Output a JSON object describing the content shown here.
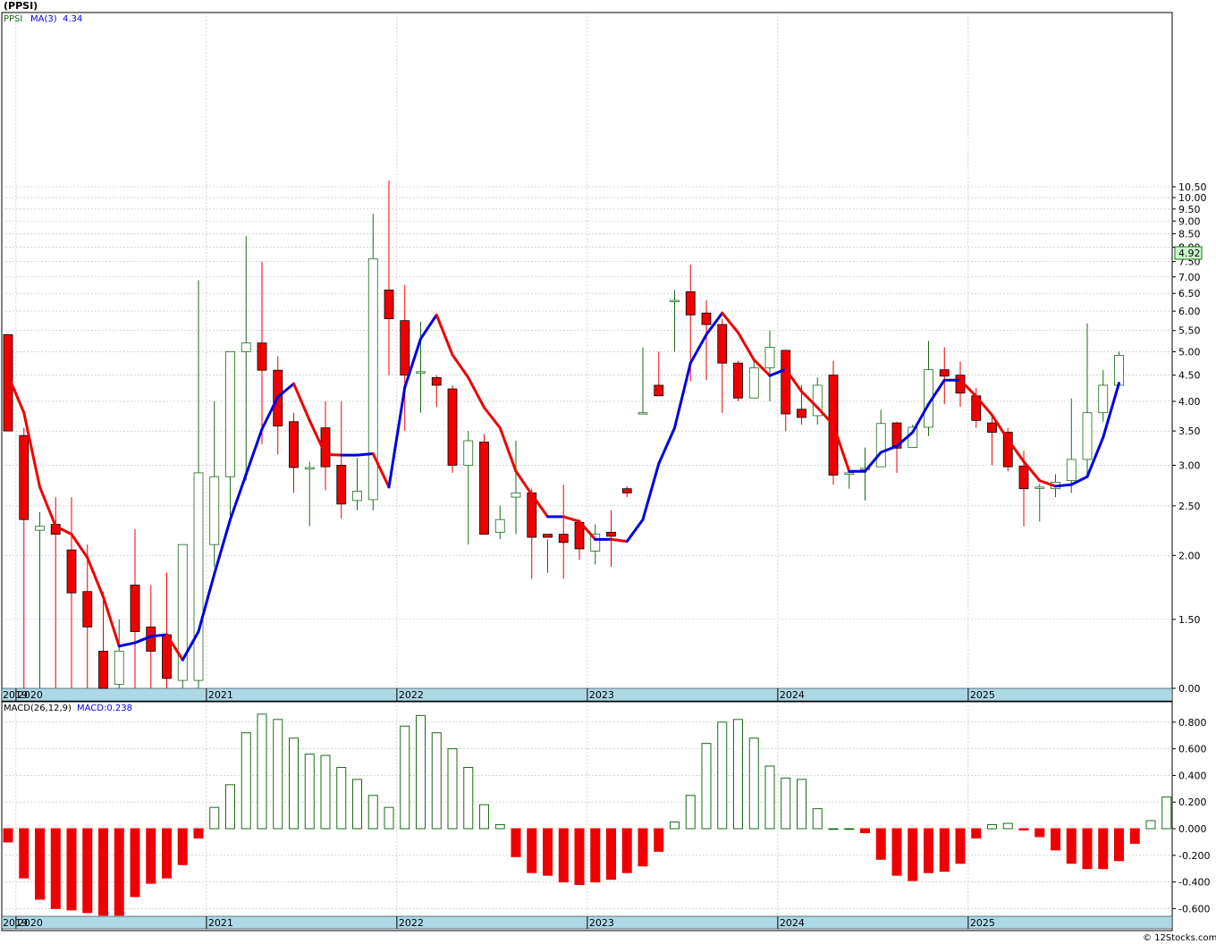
{
  "title": "(PPSI)",
  "credit": "© 12Stocks.com",
  "colors": {
    "up": "#1a6b1a",
    "down": "#ee0000",
    "ma_up": "#0000dd",
    "ma_down": "#ee0000",
    "axis_band": "#add8e6",
    "last_price_bg": "#ccffcc"
  },
  "price_panel": {
    "legend": {
      "symbol": "PPSI",
      "ma_label": "MA(3)",
      "ma_value": "4.34"
    },
    "last_price": "4.92",
    "y_ticks": [
      "10.50",
      "10.00",
      "9.50",
      "9.00",
      "8.50",
      "8.00",
      "7.50",
      "7.00",
      "6.50",
      "6.00",
      "5.50",
      "5.00",
      "4.50",
      "4.00",
      "3.50",
      "3.00",
      "2.50",
      "2.00",
      "1.50",
      "0.00"
    ],
    "year_labels": [
      "2019",
      "2020",
      "2021",
      "2022",
      "2023",
      "2024",
      "2025"
    ]
  },
  "macd_panel": {
    "legend": {
      "label": "MACD(26,12,9)",
      "value_label": "MACD:0.238"
    },
    "y_ticks": [
      "0.800",
      "0.600",
      "0.400",
      "0.200",
      "0.000",
      "-0.200",
      "-0.400",
      "-0.600"
    ],
    "year_labels": [
      "2019",
      "2020",
      "2021",
      "2022",
      "2023",
      "2024",
      "2025"
    ]
  },
  "chart_data": [
    {
      "type": "candlestick",
      "title": "(PPSI)",
      "x": [
        "2019-12",
        "2020-01",
        "2020-02",
        "2020-03",
        "2020-04",
        "2020-05",
        "2020-06",
        "2020-07",
        "2020-08",
        "2020-09",
        "2020-10",
        "2020-11",
        "2020-12",
        "2021-01",
        "2021-02",
        "2021-03",
        "2021-04",
        "2021-05",
        "2021-06",
        "2021-07",
        "2021-08",
        "2021-09",
        "2021-10",
        "2021-11",
        "2021-12",
        "2022-01",
        "2022-02",
        "2022-03",
        "2022-04",
        "2022-05",
        "2022-06",
        "2022-07",
        "2022-08",
        "2022-09",
        "2022-10",
        "2022-11",
        "2022-12",
        "2023-01",
        "2023-02",
        "2023-03",
        "2023-04",
        "2023-05",
        "2023-06",
        "2023-07",
        "2023-08",
        "2023-09",
        "2023-10",
        "2023-11",
        "2023-12",
        "2024-01",
        "2024-02",
        "2024-03",
        "2024-04",
        "2024-05",
        "2024-06",
        "2024-07",
        "2024-08",
        "2024-09",
        "2024-10",
        "2024-11",
        "2024-12",
        "2025-01",
        "2025-02",
        "2025-03",
        "2025-04",
        "2025-05",
        "2025-06",
        "2025-07",
        "2025-08",
        "2025-09",
        "2025-10",
        "2025-11",
        "2025-12"
      ],
      "open": [
        5.4,
        3.43,
        2.24,
        2.3,
        2.05,
        1.7,
        1.3,
        1.12,
        1.75,
        1.45,
        1.4,
        1.14,
        1.14,
        2.1,
        2.85,
        5.0,
        5.2,
        4.6,
        3.65,
        2.95,
        3.55,
        3.0,
        2.56,
        2.57,
        6.6,
        5.75,
        4.55,
        4.45,
        4.23,
        3.0,
        3.33,
        2.22,
        2.6,
        2.65,
        2.2,
        2.2,
        2.32,
        2.04,
        2.22,
        2.7,
        3.8,
        4.3,
        6.3,
        6.55,
        5.95,
        5.65,
        4.75,
        4.06,
        4.65,
        5.03,
        3.86,
        3.75,
        4.5,
        2.88,
        2.95,
        2.98,
        3.63,
        3.25,
        3.56,
        4.61,
        4.5,
        4.1,
        3.63,
        3.48,
        2.99,
        2.72,
        2.7,
        2.8,
        3.08,
        3.8,
        4.3
      ],
      "close": [
        3.5,
        2.35,
        2.28,
        2.2,
        1.69,
        1.45,
        1.1,
        1.3,
        1.42,
        1.3,
        1.15,
        2.1,
        2.9,
        2.85,
        5.0,
        5.2,
        4.6,
        3.58,
        2.97,
        2.97,
        2.98,
        2.52,
        2.67,
        7.6,
        5.8,
        4.5,
        4.57,
        4.3,
        3.0,
        3.35,
        2.2,
        2.35,
        2.65,
        2.17,
        2.17,
        2.12,
        2.06,
        2.2,
        2.18,
        2.65,
        3.8,
        4.1,
        6.3,
        5.9,
        5.65,
        4.75,
        4.06,
        4.65,
        5.1,
        3.78,
        3.72,
        4.3,
        2.87,
        2.9,
        2.96,
        3.62,
        3.24,
        3.56,
        4.61,
        4.48,
        4.15,
        3.67,
        3.48,
        2.98,
        2.7,
        2.72,
        2.78,
        3.08,
        3.8,
        4.3,
        4.92
      ],
      "high": [
        5.4,
        3.55,
        2.43,
        2.6,
        2.6,
        2.1,
        1.7,
        1.5,
        2.25,
        1.75,
        1.85,
        1.9,
        6.9,
        4.0,
        4.5,
        8.4,
        7.5,
        4.9,
        3.8,
        3.05,
        4.0,
        4.0,
        3.1,
        9.3,
        10.8,
        6.75,
        5.72,
        4.5,
        4.3,
        3.5,
        3.45,
        2.5,
        3.35,
        2.7,
        2.15,
        2.75,
        2.35,
        2.3,
        2.45,
        2.73,
        5.1,
        5.0,
        6.6,
        7.4,
        6.3,
        5.8,
        4.8,
        4.83,
        5.5,
        5.03,
        4.3,
        4.45,
        4.8,
        2.95,
        3.25,
        3.85,
        3.65,
        3.6,
        5.25,
        5.1,
        4.78,
        4.25,
        3.75,
        3.55,
        3.2,
        2.76,
        2.88,
        4.05,
        5.68,
        4.6,
        5.0
      ],
      "low": [
        3.5,
        0.0,
        0.0,
        0.0,
        0.0,
        0.0,
        0.0,
        0.0,
        0.0,
        0.0,
        0.0,
        0.0,
        0.0,
        1.9,
        2.35,
        2.8,
        3.3,
        3.15,
        2.65,
        2.28,
        2.68,
        2.36,
        2.45,
        2.45,
        4.5,
        3.5,
        3.8,
        3.9,
        2.9,
        2.1,
        2.2,
        2.15,
        2.2,
        1.8,
        1.85,
        1.8,
        1.96,
        1.92,
        1.9,
        2.6,
        3.8,
        4.1,
        5.0,
        4.38,
        4.4,
        3.8,
        4.0,
        4.05,
        4.0,
        3.5,
        3.6,
        3.6,
        2.75,
        2.7,
        2.56,
        2.99,
        2.9,
        3.25,
        3.42,
        3.95,
        3.9,
        3.55,
        3.0,
        2.92,
        2.28,
        2.33,
        2.6,
        2.65,
        2.85,
        3.65,
        4.28
      ],
      "ma3": [
        4.5,
        3.8,
        2.72,
        2.28,
        2.2,
        1.98,
        1.66,
        1.33,
        1.35,
        1.39,
        1.4,
        1.25,
        1.42,
        1.84,
        2.35,
        2.88,
        3.53,
        4.08,
        4.33,
        3.67,
        3.15,
        3.14,
        3.14,
        3.16,
        2.72,
        4.26,
        5.3,
        5.9,
        4.93,
        4.45,
        3.89,
        3.55,
        2.92,
        2.63,
        2.38,
        2.38,
        2.33,
        2.15,
        2.15,
        2.13,
        2.35,
        3.02,
        3.55,
        4.75,
        5.4,
        5.95,
        5.45,
        4.82,
        4.49,
        4.62,
        4.18,
        3.89,
        3.6,
        2.92,
        2.92,
        3.18,
        3.27,
        3.48,
        3.95,
        4.4,
        4.4,
        4.09,
        3.76,
        3.37,
        3.05,
        2.8,
        2.73,
        2.75,
        2.85,
        3.4,
        4.34
      ],
      "ylabel": "",
      "scale": "log"
    },
    {
      "type": "bar",
      "title": "MACD(26,12,9)",
      "x": [
        "2019-12",
        "2020-01",
        "2020-02",
        "2020-03",
        "2020-04",
        "2020-05",
        "2020-06",
        "2020-07",
        "2020-08",
        "2020-09",
        "2020-10",
        "2020-11",
        "2020-12",
        "2021-01",
        "2021-02",
        "2021-03",
        "2021-04",
        "2021-05",
        "2021-06",
        "2021-07",
        "2021-08",
        "2021-09",
        "2021-10",
        "2021-11",
        "2021-12",
        "2022-01",
        "2022-02",
        "2022-03",
        "2022-04",
        "2022-05",
        "2022-06",
        "2022-07",
        "2022-08",
        "2022-09",
        "2022-10",
        "2022-11",
        "2022-12",
        "2023-01",
        "2023-02",
        "2023-03",
        "2023-04",
        "2023-05",
        "2023-06",
        "2023-07",
        "2023-08",
        "2023-09",
        "2023-10",
        "2023-11",
        "2023-12",
        "2024-01",
        "2024-02",
        "2024-03",
        "2024-04",
        "2024-05",
        "2024-06",
        "2024-07",
        "2024-08",
        "2024-09",
        "2024-10",
        "2024-11",
        "2024-12",
        "2025-01",
        "2025-02",
        "2025-03",
        "2025-04",
        "2025-05",
        "2025-06",
        "2025-07",
        "2025-08",
        "2025-09",
        "2025-10",
        "2025-11",
        "2025-12"
      ],
      "values": [
        -0.1,
        -0.37,
        -0.53,
        -0.6,
        -0.61,
        -0.63,
        -0.65,
        -0.65,
        -0.51,
        -0.41,
        -0.37,
        -0.27,
        -0.07,
        0.16,
        0.33,
        0.72,
        0.86,
        0.82,
        0.68,
        0.56,
        0.55,
        0.46,
        0.37,
        0.25,
        0.16,
        0.77,
        0.85,
        0.72,
        0.6,
        0.46,
        0.18,
        0.03,
        -0.21,
        -0.33,
        -0.35,
        -0.4,
        -0.42,
        -0.4,
        -0.38,
        -0.33,
        -0.28,
        -0.17,
        0.05,
        0.25,
        0.64,
        0.8,
        0.82,
        0.68,
        0.47,
        0.38,
        0.37,
        0.15,
        0.0,
        0.0,
        -0.03,
        -0.23,
        -0.35,
        -0.39,
        -0.33,
        -0.32,
        -0.26,
        -0.07,
        0.03,
        0.04,
        -0.01,
        -0.06,
        -0.16,
        -0.26,
        -0.3,
        -0.3,
        -0.24,
        -0.11,
        0.06,
        0.238
      ],
      "ylim": [
        -0.66,
        0.88
      ]
    }
  ]
}
